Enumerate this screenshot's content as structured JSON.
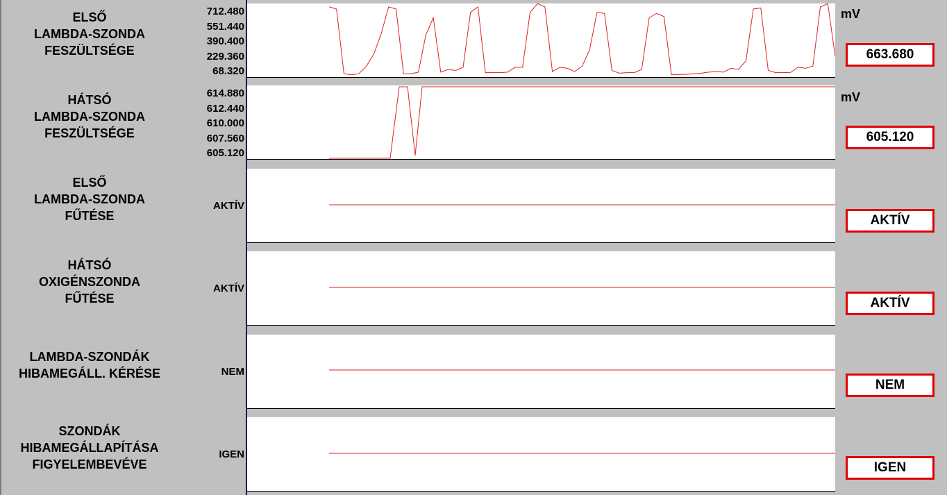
{
  "colors": {
    "background": "#c0c0c0",
    "trace": "#dd2222",
    "value_border": "#e00000"
  },
  "panels": [
    {
      "label": "ELSŐ\nLAMBDA-SZONDA\nFESZÜLTSÉGE",
      "ticks": [
        "712.480",
        "551.440",
        "390.400",
        "229.360",
        "68.320"
      ],
      "unit": "mV",
      "value": "663.680",
      "ymin": 68.32,
      "ymax": 712.48,
      "series": [
        700,
        680,
        80,
        70,
        80,
        150,
        260,
        450,
        700,
        680,
        80,
        80,
        95,
        440,
        600,
        95,
        120,
        110,
        140,
        650,
        700,
        90,
        90,
        90,
        95,
        140,
        140,
        650,
        730,
        700,
        100,
        140,
        130,
        100,
        150,
        300,
        650,
        640,
        110,
        85,
        90,
        90,
        120,
        600,
        640,
        610,
        70,
        72,
        75,
        80,
        85,
        95,
        100,
        95,
        130,
        120,
        200,
        680,
        690,
        110,
        90,
        90,
        92,
        140,
        130,
        150,
        700,
        730,
        240
      ]
    },
    {
      "label": "HÁTSÓ\nLAMBDA-SZONDA\nFESZÜLTSÉGE",
      "ticks": [
        "614.880",
        "612.440",
        "610.000",
        "607.560",
        "605.120"
      ],
      "unit": "mV",
      "value": "605.120",
      "ymin": 605.12,
      "ymax": 614.88
    },
    {
      "label": "ELSŐ\nLAMBDA-SZONDA\nFŰTÉSE",
      "state_label": "AKTÍV",
      "value": "AKTÍV"
    },
    {
      "label": "HÁTSÓ\nOXIGÉNSZONDA\nFŰTÉSE",
      "state_label": "AKTÍV",
      "value": "AKTÍV"
    },
    {
      "label": "LAMBDA-SZONDÁK\nHIBAMEGÁLL. KÉRÉSE",
      "state_label": "NEM",
      "value": "NEM"
    },
    {
      "label": "SZONDÁK\nHIBAMEGÁLLAPÍTÁSA\nFIGYELEMBEVÉVE",
      "state_label": "IGEN",
      "value": "IGEN"
    }
  ]
}
